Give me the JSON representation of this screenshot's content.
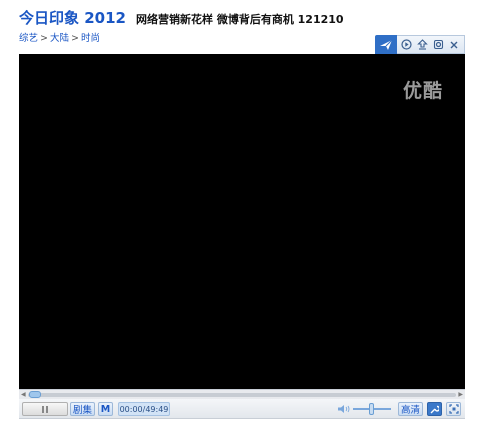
{
  "header": {
    "show_title": "今日印象 2012",
    "episode_title": "网络营销新花样 微博背后有商机 121210"
  },
  "breadcrumb": [
    "综艺",
    "大陆",
    "时尚"
  ],
  "breadcrumb_separator": ">",
  "player": {
    "watermark": "优酷",
    "top_icons": [
      "share-icon",
      "play-circle-icon",
      "upload-icon",
      "gear-icon",
      "close-icon"
    ],
    "progress": 0.0
  },
  "controls": {
    "episodes_label": "剧集",
    "next_label": "M",
    "time": "00:00/49:49",
    "quality_label": "高清",
    "volume": 0.45
  },
  "colors": {
    "accent": "#1a56c4",
    "video_bg": "#000000",
    "share_button": "#2f6fc6"
  }
}
